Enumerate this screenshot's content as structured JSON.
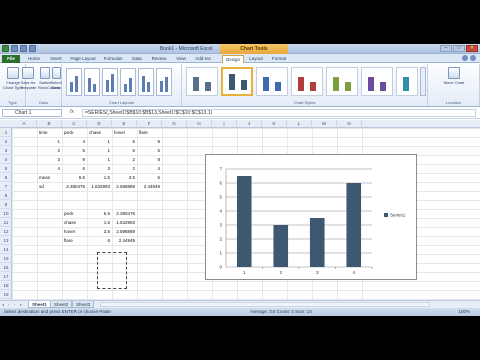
{
  "title": "Book1 - Microsoft Excel",
  "chart_tools_label": "Chart Tools",
  "tabs": [
    "File",
    "Home",
    "Insert",
    "Page Layout",
    "Formulas",
    "Data",
    "Review",
    "View",
    "Add-Ins",
    "Design",
    "Layout",
    "Format"
  ],
  "ribbon": {
    "type_group": {
      "button": "Change Chart Type",
      "label": "Type"
    },
    "save_template": "Save As Template",
    "data_group": {
      "switch": "Switch Row/Column",
      "select": "Select Data",
      "label": "Data"
    },
    "layouts_label": "Chart Layouts",
    "styles_label": "Chart Styles",
    "location_group": {
      "button": "Move Chart",
      "label": "Location"
    }
  },
  "name_box": "Chart 1",
  "fx": "fx",
  "formula": "=SERIES(,Sheet1!$B$10:$B$13,Sheet1!$C$10:$C$13,1)",
  "columns": [
    "A",
    "B",
    "C",
    "D",
    "E",
    "F",
    "G",
    "H",
    "I",
    "J",
    "K",
    "L",
    "M",
    "N"
  ],
  "rows": [
    "1",
    "2",
    "3",
    "4",
    "5",
    "6",
    "7",
    "8",
    "9",
    "10",
    "11",
    "12",
    "13",
    "14",
    "15",
    "16",
    "17",
    "18",
    "19"
  ],
  "table": {
    "header": [
      "time",
      "peck",
      "chase",
      "hover",
      "flare"
    ],
    "data": [
      [
        "1",
        "4",
        "1",
        "6",
        "9"
      ],
      [
        "2",
        "5",
        "1",
        "6",
        "5"
      ],
      [
        "3",
        "9",
        "1",
        "2",
        "8"
      ],
      [
        "4",
        "6",
        "3",
        "2",
        "4"
      ]
    ],
    "mean_label": "mean",
    "means": [
      "6.5",
      "1.5",
      "3.5",
      "6"
    ],
    "sd_label": "sd",
    "sds": [
      "2.380476",
      "1.632993",
      "2.598889",
      "2.44949"
    ]
  },
  "summary": {
    "labels": [
      "peck",
      "chase",
      "hover",
      "flare"
    ],
    "means": [
      "6.5",
      "1.5",
      "3.5",
      "6"
    ],
    "sds": [
      "2.380476",
      "1.632993",
      "2.598889",
      "2.44949"
    ]
  },
  "chart_data": {
    "type": "bar",
    "categories": [
      "1",
      "2",
      "3",
      "4"
    ],
    "series": [
      {
        "name": "Series1",
        "values": [
          6.5,
          3,
          3.5,
          6
        ]
      }
    ],
    "title": "",
    "xlabel": "",
    "ylabel": "",
    "ylim": [
      0,
      7
    ],
    "yticks": [
      "0",
      "1",
      "2",
      "3",
      "4",
      "5",
      "6",
      "7"
    ],
    "grid": true,
    "legend": "right"
  },
  "colors": {
    "bar": "#3e5871",
    "file_tab": "#2a6f2e",
    "chart_tools": "#e9a73b"
  },
  "sheets": [
    "Sheet1",
    "Sheet2",
    "Sheet3"
  ],
  "status": {
    "left": "Select destination and press ENTER or choose Paste",
    "middle": "Average: 3.5   Count: 4   Sum: 14",
    "zoom": "100%"
  }
}
